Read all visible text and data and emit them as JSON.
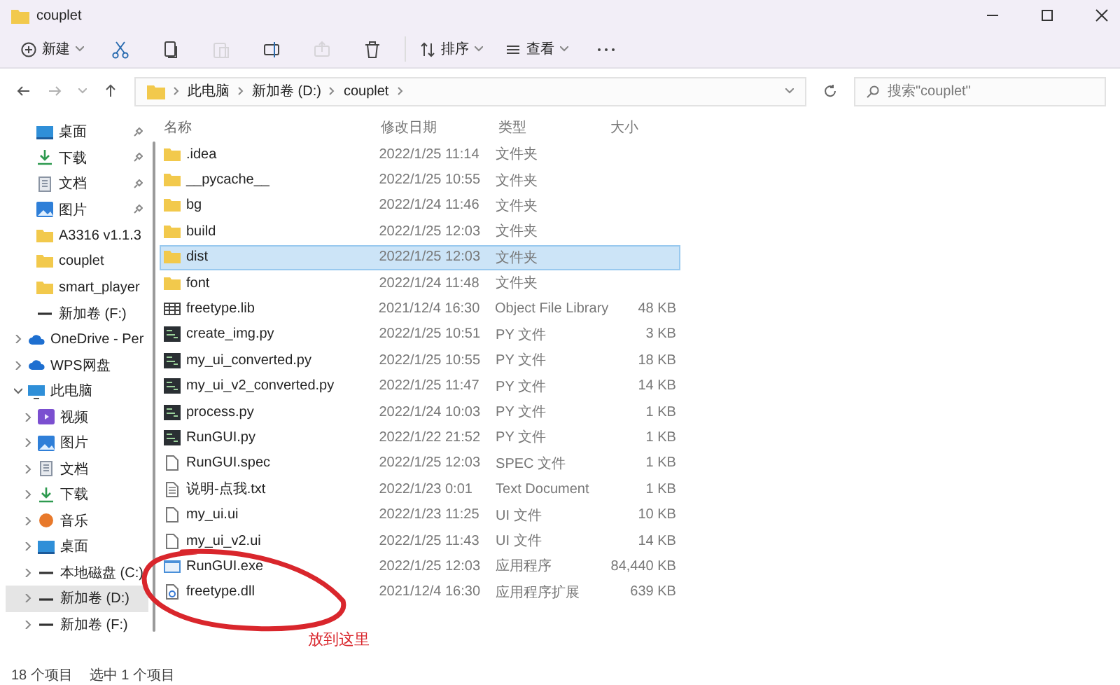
{
  "window": {
    "title": "couplet"
  },
  "toolbar": [
    {
      "kind": "new",
      "label": "新建",
      "disabled": false
    },
    {
      "kind": "cut",
      "disabled": false
    },
    {
      "kind": "copy",
      "disabled": false
    },
    {
      "kind": "paste",
      "disabled": true
    },
    {
      "kind": "rename",
      "disabled": false
    },
    {
      "kind": "share",
      "disabled": true
    },
    {
      "kind": "delete",
      "disabled": false
    },
    {
      "kind": "sort",
      "label": "排序",
      "disabled": false
    },
    {
      "kind": "view",
      "label": "查看",
      "disabled": false
    },
    {
      "kind": "more",
      "disabled": false
    }
  ],
  "address": {
    "path": [
      "此电脑",
      "新加卷 (D:)",
      "couplet"
    ]
  },
  "search": {
    "placeholder": "搜索\"couplet\""
  },
  "sidebar": {
    "items": [
      {
        "label": "桌面",
        "kind": "desktop",
        "pinned": true,
        "selected": false
      },
      {
        "label": "下载",
        "kind": "download",
        "pinned": true,
        "selected": false
      },
      {
        "label": "文档",
        "kind": "document",
        "pinned": true,
        "selected": false
      },
      {
        "label": "图片",
        "kind": "picture",
        "pinned": true,
        "selected": false
      },
      {
        "label": "A3316 v1.1.3",
        "kind": "folder",
        "pinned": false,
        "selected": false
      },
      {
        "label": "couplet",
        "kind": "folder",
        "pinned": false,
        "selected": false
      },
      {
        "label": "smart_player",
        "kind": "folder",
        "pinned": false,
        "selected": false
      },
      {
        "label": "新加卷 (F:)",
        "kind": "drive",
        "pinned": false,
        "selected": false
      },
      {
        "label": "OneDrive - Per",
        "kind": "cloud",
        "expanded": false,
        "selected": false
      },
      {
        "label": "WPS网盘",
        "kind": "cloud",
        "expanded": false,
        "selected": false
      },
      {
        "label": "此电脑",
        "kind": "pc",
        "expanded": true,
        "selected": false,
        "children": [
          {
            "label": "视频",
            "kind": "video",
            "expanded": false,
            "selected": false
          },
          {
            "label": "图片",
            "kind": "picture",
            "expanded": false,
            "selected": false
          },
          {
            "label": "文档",
            "kind": "document",
            "expanded": false,
            "selected": false
          },
          {
            "label": "下载",
            "kind": "download",
            "expanded": false,
            "selected": false
          },
          {
            "label": "音乐",
            "kind": "music",
            "expanded": false,
            "selected": false
          },
          {
            "label": "桌面",
            "kind": "desktop",
            "expanded": false,
            "selected": false
          },
          {
            "label": "本地磁盘 (C:)",
            "kind": "drive",
            "expanded": false,
            "selected": false
          },
          {
            "label": "新加卷 (D:)",
            "kind": "drive",
            "expanded": false,
            "selected": true
          },
          {
            "label": "新加卷 (F:)",
            "kind": "drive",
            "expanded": false,
            "selected": false
          }
        ]
      }
    ]
  },
  "table": {
    "columns": [
      "名称",
      "修改日期",
      "类型",
      "大小"
    ],
    "rows": [
      {
        "kind": "folder",
        "name": ".idea",
        "date": "2022/1/25 11:14",
        "type": "文件夹",
        "selected": false
      },
      {
        "kind": "folder",
        "name": "__pycache__",
        "date": "2022/1/25 10:55",
        "type": "文件夹",
        "selected": false
      },
      {
        "kind": "folder",
        "name": "bg",
        "date": "2022/1/24 11:46",
        "type": "文件夹",
        "selected": false
      },
      {
        "kind": "folder",
        "name": "build",
        "date": "2022/1/25 12:03",
        "type": "文件夹",
        "selected": false
      },
      {
        "kind": "folder",
        "name": "dist",
        "date": "2022/1/25 12:03",
        "type": "文件夹",
        "selected": true
      },
      {
        "kind": "folder",
        "name": "font",
        "date": "2022/1/24 11:48",
        "type": "文件夹",
        "selected": false
      },
      {
        "kind": "lib",
        "name": "freetype.lib",
        "date": "2021/12/4 16:30",
        "type": "Object File Library",
        "size": "48 KB",
        "selected": false
      },
      {
        "kind": "py",
        "name": "create_img.py",
        "date": "2022/1/25 10:51",
        "type": "PY 文件",
        "size": "3 KB",
        "selected": false
      },
      {
        "kind": "py",
        "name": "my_ui_converted.py",
        "date": "2022/1/25 10:55",
        "type": "PY 文件",
        "size": "18 KB",
        "selected": false
      },
      {
        "kind": "py",
        "name": "my_ui_v2_converted.py",
        "date": "2022/1/25 11:47",
        "type": "PY 文件",
        "size": "14 KB",
        "selected": false
      },
      {
        "kind": "py",
        "name": "process.py",
        "date": "2022/1/24 10:03",
        "type": "PY 文件",
        "size": "1 KB",
        "selected": false
      },
      {
        "kind": "py",
        "name": "RunGUI.py",
        "date": "2022/1/22 21:52",
        "type": "PY 文件",
        "size": "1 KB",
        "selected": false
      },
      {
        "kind": "file",
        "name": "RunGUI.spec",
        "date": "2022/1/25 12:03",
        "type": "SPEC 文件",
        "size": "1 KB",
        "selected": false
      },
      {
        "kind": "txt",
        "name": "说明-点我.txt",
        "date": "2022/1/23 0:01",
        "type": "Text Document",
        "size": "1 KB",
        "selected": false
      },
      {
        "kind": "file",
        "name": "my_ui.ui",
        "date": "2022/1/23 11:25",
        "type": "UI 文件",
        "size": "10 KB",
        "selected": false
      },
      {
        "kind": "file",
        "name": "my_ui_v2.ui",
        "date": "2022/1/25 11:43",
        "type": "UI 文件",
        "size": "14 KB",
        "selected": false
      },
      {
        "kind": "exe",
        "name": "RunGUI.exe",
        "date": "2022/1/25 12:03",
        "type": "应用程序",
        "size": "84,440 KB",
        "selected": false
      },
      {
        "kind": "dll",
        "name": "freetype.dll",
        "date": "2021/12/4 16:30",
        "type": "应用程序扩展",
        "size": "639 KB",
        "selected": false
      }
    ]
  },
  "annotation": {
    "text": "放到这里"
  },
  "status_bar": {
    "count": "18 个项目",
    "selection": "选中 1 个项目"
  }
}
